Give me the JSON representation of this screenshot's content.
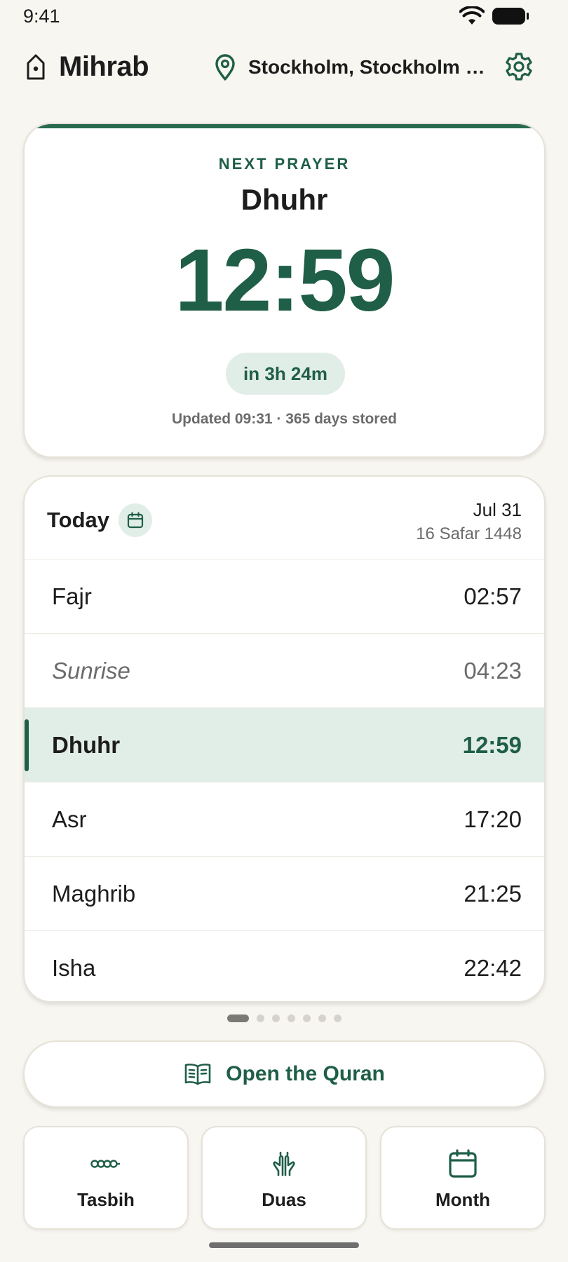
{
  "status_bar": {
    "time": "9:41"
  },
  "header": {
    "app_title": "Mihrab",
    "location": "Stockholm, Stockholm …",
    "icons": {
      "logo": "mosque-icon",
      "pin": "location-pin-icon",
      "settings": "gear-icon"
    }
  },
  "next_prayer": {
    "label": "NEXT PRAYER",
    "name": "Dhuhr",
    "time": "12:59",
    "countdown": "in 3h 24m",
    "updated": "Updated 09:31 · 365 days stored"
  },
  "today": {
    "title": "Today",
    "date": "Jul 31",
    "hijri_date": "16 Safar 1448",
    "prayers": [
      {
        "name": "Fajr",
        "time": "02:57",
        "state": "normal"
      },
      {
        "name": "Sunrise",
        "time": "04:23",
        "state": "muted"
      },
      {
        "name": "Dhuhr",
        "time": "12:59",
        "state": "active"
      },
      {
        "name": "Asr",
        "time": "17:20",
        "state": "normal"
      },
      {
        "name": "Maghrib",
        "time": "21:25",
        "state": "normal"
      },
      {
        "name": "Isha",
        "time": "22:42",
        "state": "normal"
      }
    ]
  },
  "pager": {
    "pages": 7,
    "current": 1
  },
  "quran_button": {
    "label": "Open the Quran",
    "icon": "book-icon"
  },
  "tiles": [
    {
      "label": "Tasbih",
      "icon": "prayer-beads-icon"
    },
    {
      "label": "Duas",
      "icon": "praying-hands-icon"
    },
    {
      "label": "Month",
      "icon": "calendar-icon"
    }
  ],
  "colors": {
    "accent": "#1f5e47",
    "accent_soft": "#e1ede7",
    "background": "#f8f6f1",
    "muted_text": "#6b6b6b"
  }
}
